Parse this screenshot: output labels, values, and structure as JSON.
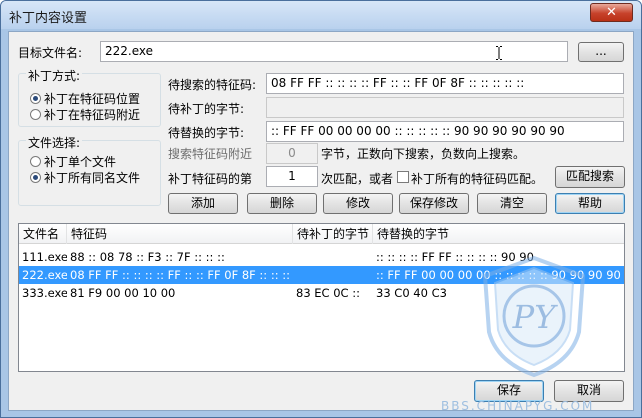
{
  "window": {
    "title": "补丁内容设置",
    "close_glyph": "✕"
  },
  "target_file": {
    "label": "目标文件名:",
    "value": "222.exe",
    "browse_label": "..."
  },
  "patch_mode": {
    "title": "补丁方式:",
    "options": [
      {
        "label": "补丁在特征码位置",
        "checked": true
      },
      {
        "label": "补丁在特征码附近",
        "checked": false
      }
    ]
  },
  "file_select": {
    "title": "文件选择:",
    "options": [
      {
        "label": "补丁单个文件",
        "checked": false
      },
      {
        "label": "补丁所有同名文件",
        "checked": true
      }
    ]
  },
  "fields": {
    "search_sig_label": "待搜索的特征码:",
    "search_sig_value": "08 FF FF :: :: :: :: FF :: :: FF 0F 8F :: :: :: :: ::",
    "patch_bytes_label": "待补丁的字节:",
    "patch_bytes_value": "",
    "replace_bytes_label": "待替换的字节:",
    "replace_bytes_value": ":: FF FF 00 00 00 00 :: :: :: :: :: 90 90 90 90 90 90",
    "near_label": "搜索特征码附近",
    "near_value": "0",
    "near_suffix": "字节，正数向下搜索，负数向上搜索。",
    "nth_label": "补丁特征码的第",
    "nth_value": "1",
    "nth_suffix": "次匹配，或者",
    "all_matches_label": "补丁所有的特征码匹配。",
    "match_search_button": "匹配搜索"
  },
  "actions": {
    "add": "添加",
    "delete": "删除",
    "modify": "修改",
    "save_modify": "保存修改",
    "clear": "清空",
    "help": "帮助"
  },
  "table": {
    "columns": [
      "文件名",
      "特征码",
      "待补丁的字节",
      "待替换的字节"
    ],
    "rows": [
      [
        "111.exe",
        "88 :: 08 78 :: F3 :: 7F :: :: ::",
        "",
        ":: :: :: :: FF FF :: :: :: :: 90 90"
      ],
      [
        "222.exe",
        "08 FF FF :: :: :: :: FF :: :: FF 0F 8F :: :: :: :: ::",
        "",
        ":: FF FF 00 00 00 00 :: :: :: :: :: 90 90 90 90 90 90"
      ],
      [
        "333.exe",
        "81 F9 00 00 10 00",
        "83 EC 0C ::",
        "33 C0 40 C3"
      ]
    ],
    "selected_row": 1
  },
  "footer": {
    "save": "保存",
    "cancel": "取消"
  },
  "watermark": {
    "logo_text": "PY",
    "site": "BBS.CHINAPYG.COM"
  },
  "colors": {
    "selection": "#3399ff",
    "titlebar": "#b9d1ee",
    "close": "#c7422b"
  }
}
